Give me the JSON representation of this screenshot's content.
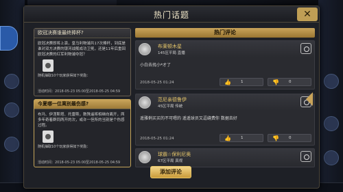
{
  "modal": {
    "title": "热门话题",
    "close_label": "✕"
  },
  "topics": [
    {
      "title": "欧冠决赛谁最终捧杯?",
      "body": "欧冠决赛即将上演，皇马利物浦共17次捧杯，到底是谁对双方决赛的银河战舰成功卫冕，还是11年后重回欧冠决赛的红军利物浦夺冠？",
      "reward": "随机抽取10个玩家获得如下奖励：",
      "time": "活动时间：2018-05-23 05:00至2018-05-25 04:59"
    },
    {
      "title": "今夏哪一位离别最伤感?",
      "body": "布冯、伊涅斯塔、托雷斯，数殊遥将相继向离开，两多年奇着群同两开的次，或许一但所的当别是个伤感过程。",
      "reward": "随机抽取10个玩家获得如下奖励：",
      "time": "活动时间：2018-05-23 05:00至2018-05-25 04:59"
    }
  ],
  "comments_title": "热门评论",
  "comments": [
    {
      "name": "布莱顿木星",
      "level": "145区平局 直播",
      "text": "小白去找小*才了",
      "date": "2018-05-25  01:24",
      "likes": "1",
      "dislikes": "0"
    },
    {
      "name": "范尼亲德鲁伊",
      "level": "45区平局 传统",
      "text": "遥雅俐买买的不可嗯的 遥遥球员又逗缝费你 数据去好",
      "date": "2018-05-25  01:24",
      "likes": "1",
      "dislikes": "0"
    },
    {
      "name": "球霸☆保利尼奥",
      "level": "67区平局 真视",
      "text": "",
      "date": "",
      "likes": "",
      "dislikes": ""
    }
  ],
  "add_comment_label": "添加评论",
  "colors": {
    "accent": "#c9a45a",
    "background": "#1e2026"
  }
}
